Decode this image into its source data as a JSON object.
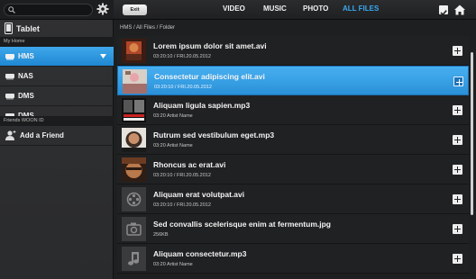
{
  "sidebar": {
    "search": {
      "value": "",
      "placeholder": ""
    },
    "device_label": "Tablet",
    "my_home_header": "My Home",
    "items": [
      {
        "label": "HMS",
        "selected": true
      },
      {
        "label": "NAS",
        "selected": false
      },
      {
        "label": "DMS",
        "selected": false
      },
      {
        "label": "DMS",
        "selected": false
      }
    ],
    "friends_header": "Friends WOON ID",
    "add_friend_label": "Add a Friend"
  },
  "topbar": {
    "exit_label": "Exit",
    "tabs": [
      {
        "label": "VIDEO",
        "active": false
      },
      {
        "label": "MUSIC",
        "active": false
      },
      {
        "label": "PHOTO",
        "active": false
      },
      {
        "label": "ALL FILES",
        "active": true
      }
    ]
  },
  "breadcrumb": "HMS  /  All Files  /  Folder",
  "files": [
    {
      "title": "Lorem ipsum dolor sit amet.avi",
      "meta": "03:20:10 / FRI.20.05.2012",
      "thumb": "video-thumbnail",
      "selected": false
    },
    {
      "title": "Consectetur adipiscing elit.avi",
      "meta": "03:20:10 / FRI.20.05.2012",
      "thumb": "video-thumbnail",
      "selected": true
    },
    {
      "title": "Aliquam ligula sapien.mp3",
      "meta": "03:20   Artist Name",
      "thumb": "album-cover",
      "selected": false
    },
    {
      "title": "Rutrum sed vestibulum eget.mp3",
      "meta": "03:20   Artist Name",
      "thumb": "album-cover",
      "selected": false
    },
    {
      "title": "Rhoncus ac erat.avi",
      "meta": "03:20:10 / FRI.20.05.2012",
      "thumb": "video-thumbnail",
      "selected": false
    },
    {
      "title": "Aliquam erat volutpat.avi",
      "meta": "03:20:10 / FRI.20.05.2012",
      "thumb": "film-reel-icon",
      "selected": false
    },
    {
      "title": "Sed convallis scelerisque enim at fermentum.jpg",
      "meta": "256KB",
      "thumb": "camera-icon",
      "selected": false
    },
    {
      "title": "Aliquam consectetur.mp3",
      "meta": "03:20   Artist Name",
      "thumb": "music-note-icon",
      "selected": false
    }
  ],
  "colors": {
    "accent": "#38aaf2",
    "selection": "#2f96dd",
    "background": "#1e1f21"
  }
}
